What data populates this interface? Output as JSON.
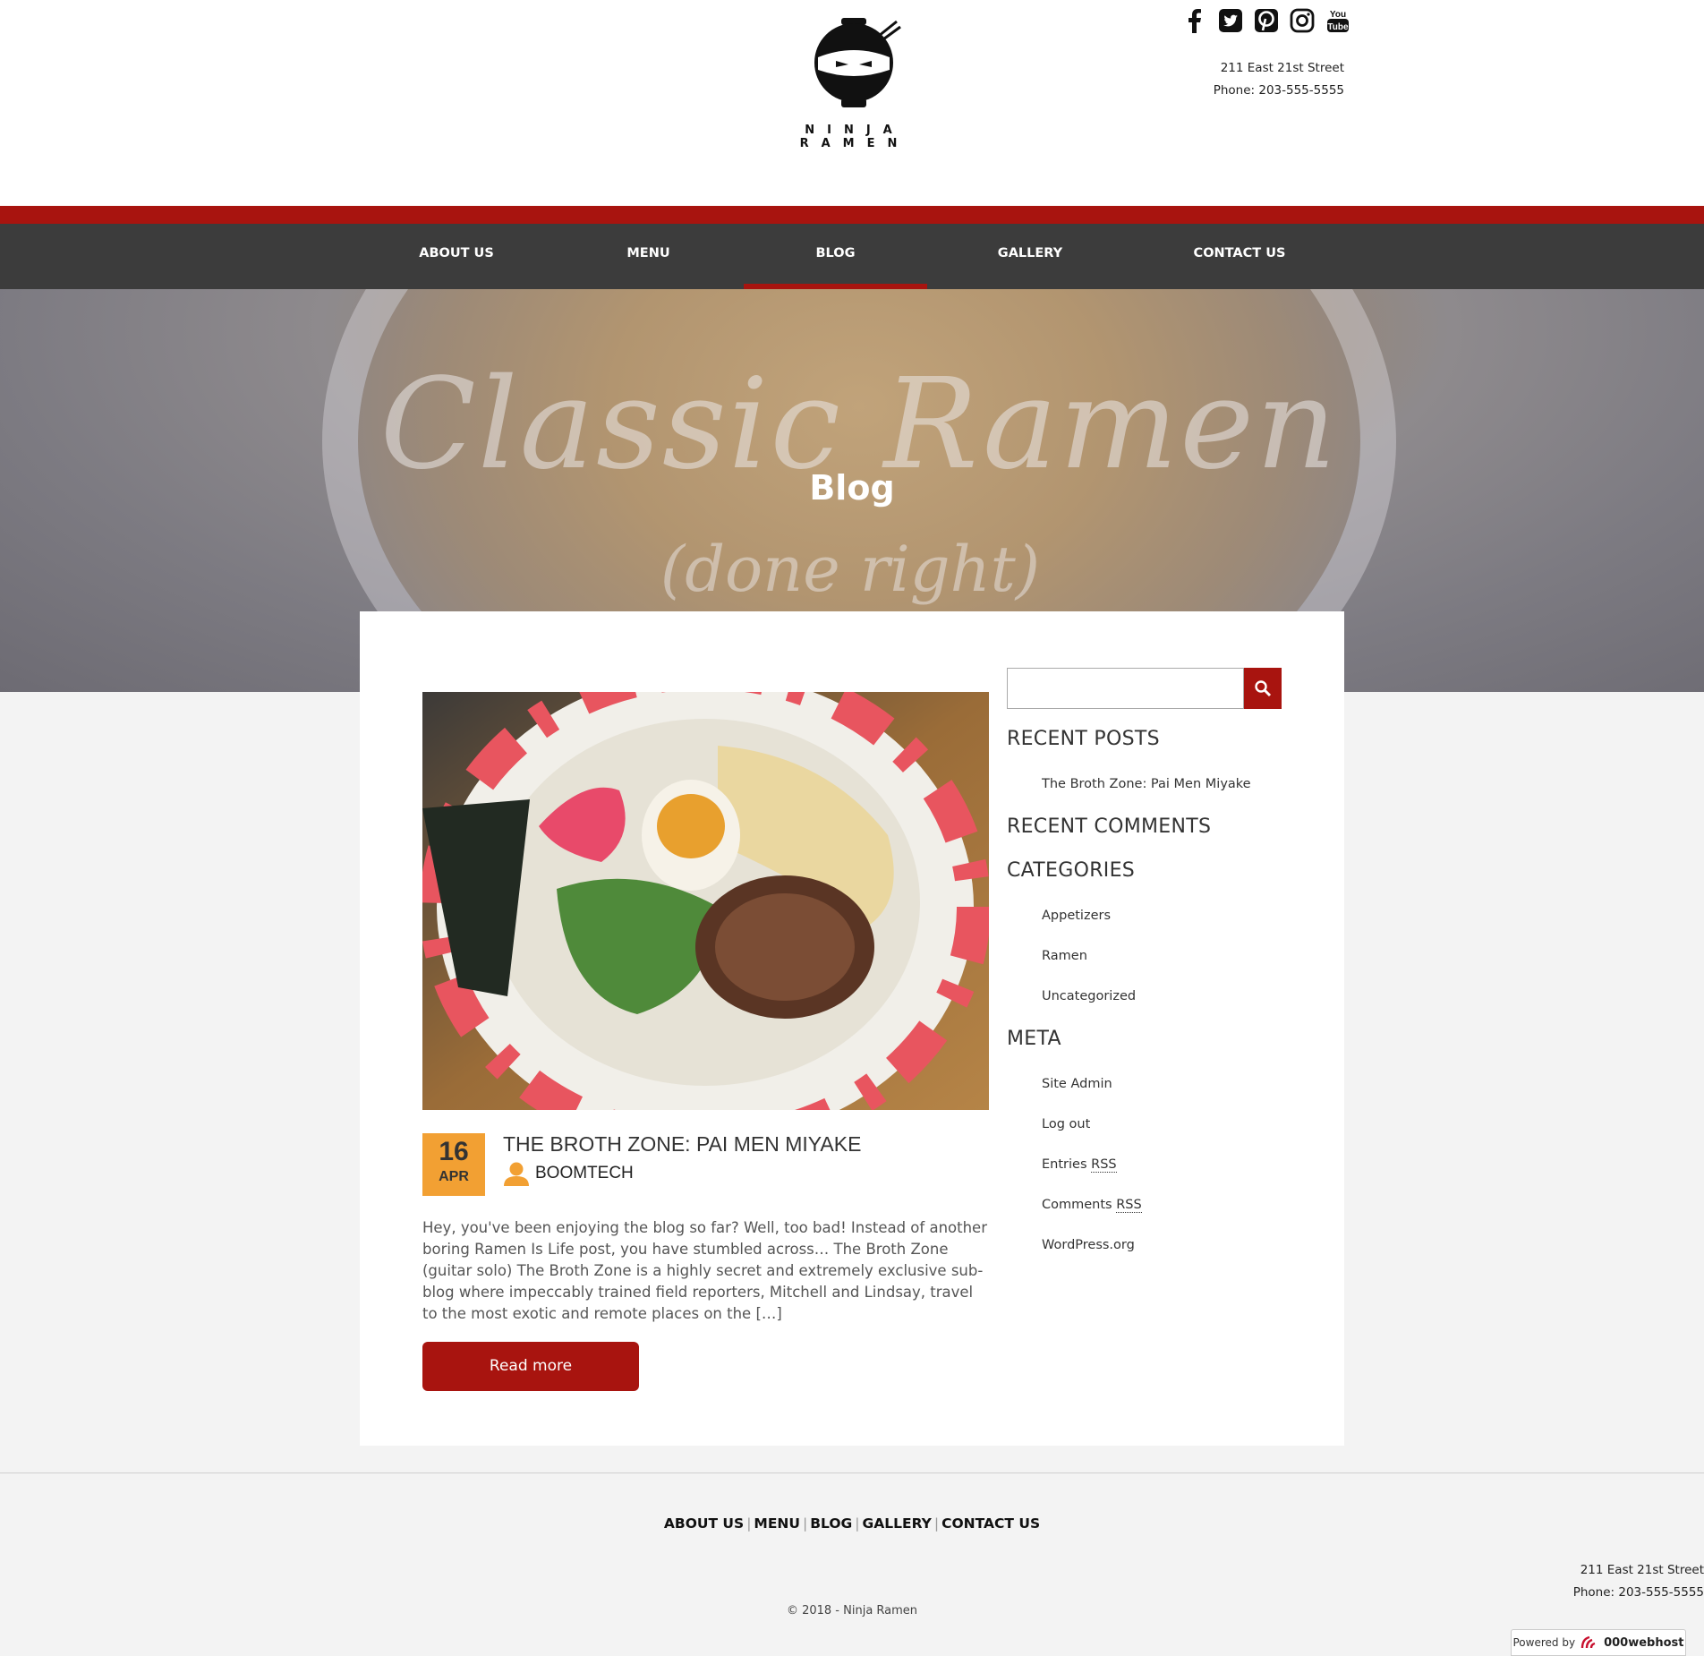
{
  "brand": {
    "name": "NINJA RAMEN"
  },
  "social": [
    {
      "name": "facebook-icon"
    },
    {
      "name": "twitter-icon"
    },
    {
      "name": "pinterest-icon"
    },
    {
      "name": "instagram-icon"
    },
    {
      "name": "youtube-icon"
    }
  ],
  "contact": {
    "street": "211 East 21st Street",
    "phone": "Phone: 203-555-5555"
  },
  "nav": {
    "items": [
      {
        "label": "ABOUT US"
      },
      {
        "label": "MENU"
      },
      {
        "label": "BLOG",
        "active": true
      },
      {
        "label": "GALLERY"
      },
      {
        "label": "CONTACT US"
      }
    ]
  },
  "hero": {
    "title": "Blog",
    "script_line1": "Classic Ramen",
    "script_line2": "(done right)"
  },
  "post": {
    "day": "16",
    "month": "APR",
    "title": "THE BROTH ZONE: PAI MEN MIYAKE",
    "author": "BOOMTECH",
    "excerpt": "Hey, you've been enjoying the blog so far? Well, too bad! Instead of another boring Ramen Is Life post, you have stumbled across… The Broth Zone (guitar solo) The Broth Zone is a highly secret and extremely exclusive sub-blog where impeccably trained field reporters, Mitchell and Lindsay, travel to the most exotic and remote places on the […]",
    "read_more": "Read more"
  },
  "sidebar": {
    "search": {
      "value": "",
      "placeholder": ""
    },
    "recent_posts": {
      "heading": "RECENT POSTS",
      "items": [
        "The Broth Zone: Pai Men Miyake"
      ]
    },
    "recent_comments": {
      "heading": "RECENT COMMENTS"
    },
    "categories": {
      "heading": "CATEGORIES",
      "items": [
        "Appetizers",
        "Ramen",
        "Uncategorized"
      ]
    },
    "meta": {
      "heading": "META",
      "site_admin": "Site Admin",
      "log_out": "Log out",
      "entries": "Entries ",
      "entries_abbr": "RSS",
      "comments": "Comments ",
      "comments_abbr": "RSS",
      "wordpress": "WordPress.org"
    }
  },
  "footer": {
    "nav": [
      "ABOUT US",
      "MENU",
      "BLOG",
      "GALLERY",
      "CONTACT US"
    ],
    "separator": "|",
    "street": "211 East 21st Street",
    "phone": "Phone: 203-555-5555",
    "copyright": "© 2018 - Ninja Ramen",
    "powered_by": "Powered by",
    "host": "000webhost"
  },
  "colors": {
    "accent_red": "#a8140f",
    "nav_bg": "#3c3c3c",
    "date_orange": "#f2a033"
  }
}
